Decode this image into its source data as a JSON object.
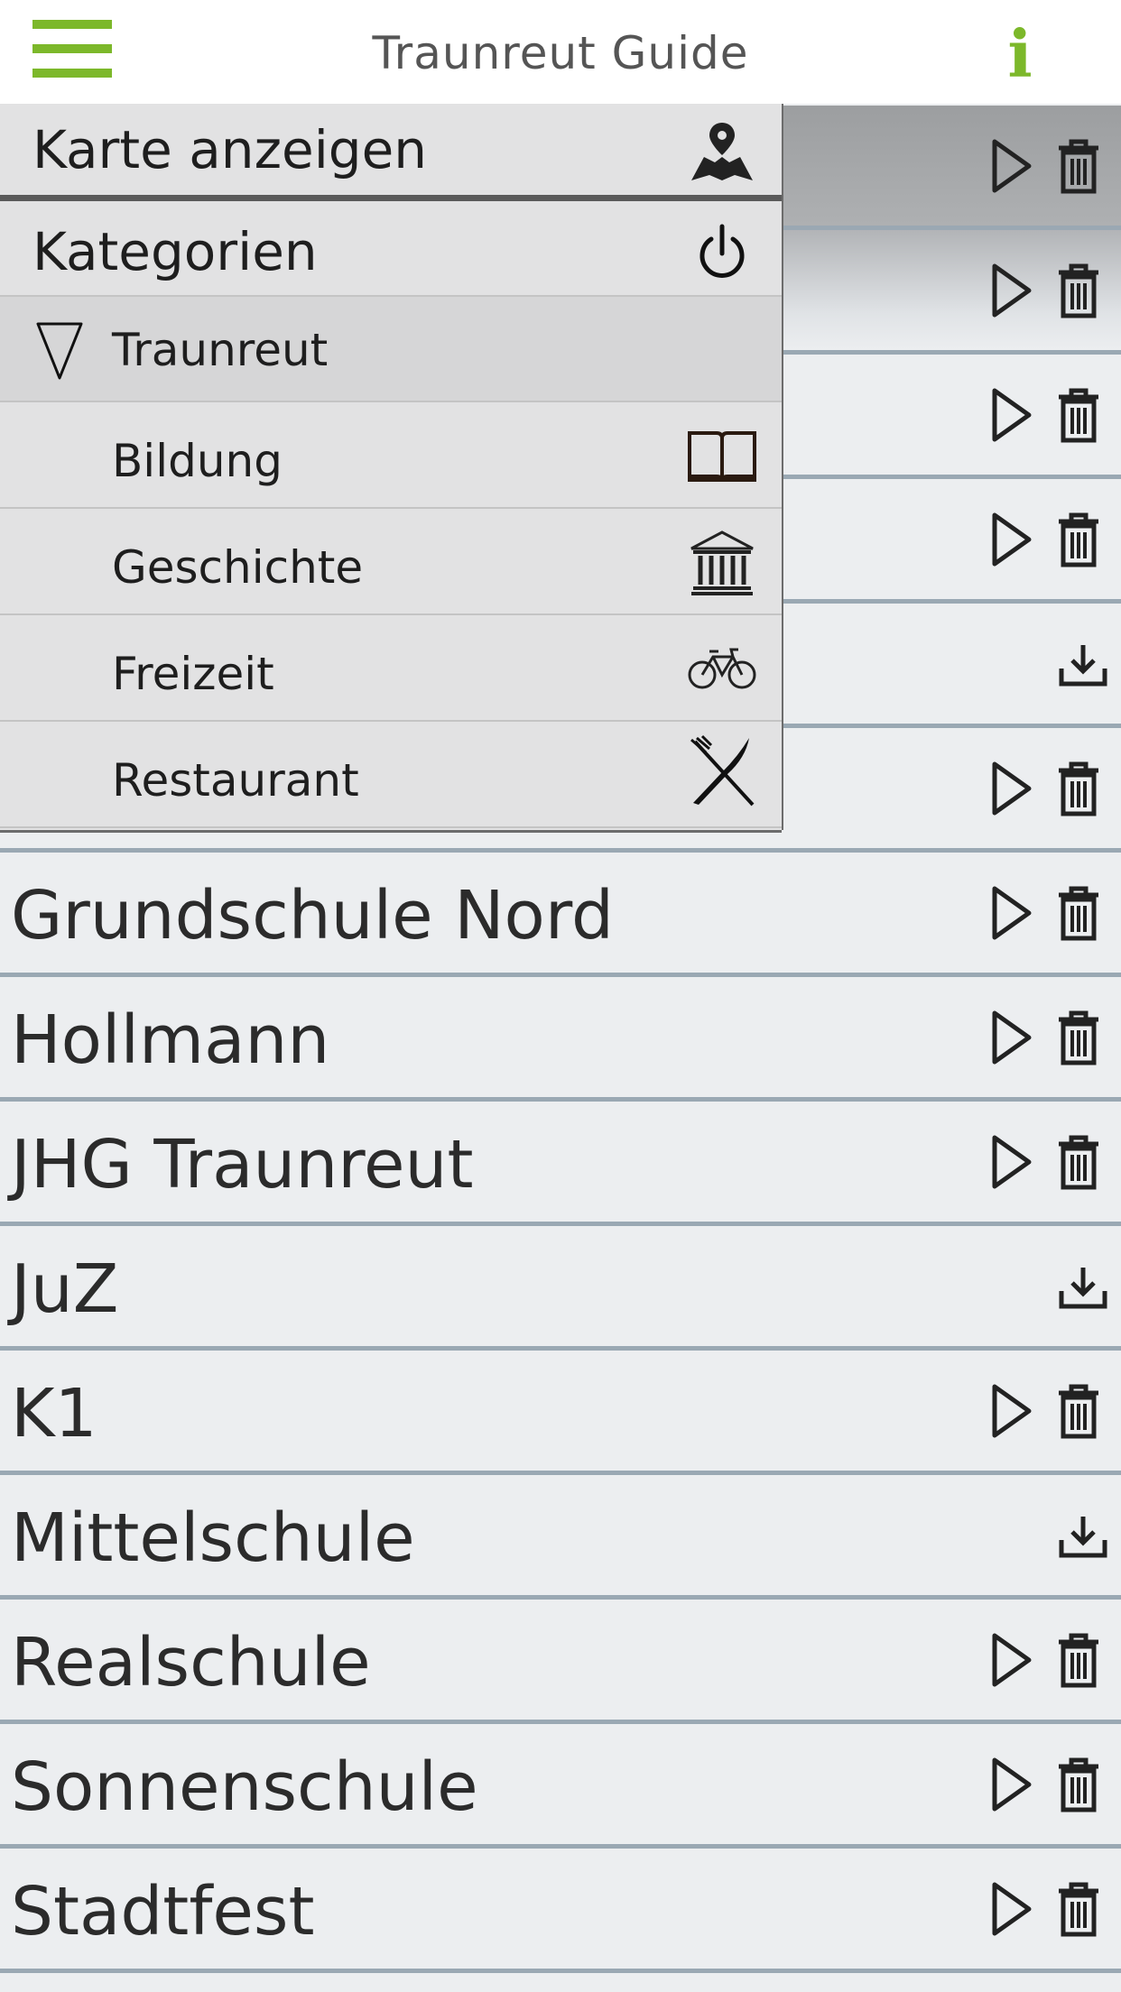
{
  "header": {
    "title": "Traunreut Guide",
    "menu_icon": "hamburger-menu-icon",
    "info_icon": "info-icon",
    "info_label": "i",
    "accent_color": "#7cb82a"
  },
  "drawer": {
    "map_label": "Karte anzeigen",
    "map_icon": "map-pin-icon",
    "categories_label": "Kategorien",
    "categories_icon": "power-icon",
    "group_label": "Traunreut",
    "group_icon": "triangle-down-icon",
    "categories": [
      {
        "label": "Bildung",
        "icon": "book-icon"
      },
      {
        "label": "Geschichte",
        "icon": "museum-icon"
      },
      {
        "label": "Freizeit",
        "icon": "bicycle-icon"
      },
      {
        "label": "Restaurant",
        "icon": "fork-knife-icon"
      }
    ]
  },
  "list": {
    "items": [
      {
        "label": "",
        "actions": "play-delete"
      },
      {
        "label": "",
        "actions": "play-delete"
      },
      {
        "label": "",
        "actions": "play-delete"
      },
      {
        "label": "",
        "actions": "play-delete"
      },
      {
        "label": "",
        "actions": "download"
      },
      {
        "label": "",
        "actions": "play-delete"
      },
      {
        "label": "Grundschule Nord",
        "actions": "play-delete"
      },
      {
        "label": "Hollmann",
        "actions": "play-delete"
      },
      {
        "label": "JHG Traunreut",
        "actions": "play-delete"
      },
      {
        "label": "JuZ",
        "actions": "download"
      },
      {
        "label": "K1",
        "actions": "play-delete"
      },
      {
        "label": "Mittelschule",
        "actions": "download"
      },
      {
        "label": "Realschule",
        "actions": "play-delete"
      },
      {
        "label": "Sonnenschule",
        "actions": "play-delete"
      },
      {
        "label": "Stadtfest",
        "actions": "play-delete"
      }
    ]
  }
}
